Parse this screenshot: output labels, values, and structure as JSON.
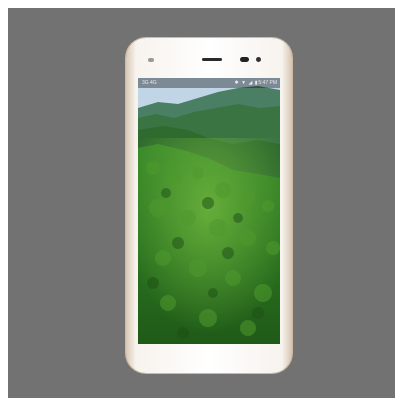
{
  "image": {
    "subject": "smartphone-render",
    "background_color": "#727272",
    "phone_color": "#f8f6f2"
  },
  "status_bar": {
    "left_text": "3G 4G",
    "time": "5:47 PM",
    "icons": [
      "bluetooth-icon",
      "wifi-icon",
      "signal-icon",
      "battery-icon"
    ]
  },
  "wallpaper": {
    "description": "forested-hills",
    "colors": {
      "sky": "#c7d8e6",
      "far_ridge": "#3f7a5a",
      "mid_ridge": "#356e3a",
      "foreground": "#2f7a22",
      "highlight": "#6fbf3a"
    }
  }
}
